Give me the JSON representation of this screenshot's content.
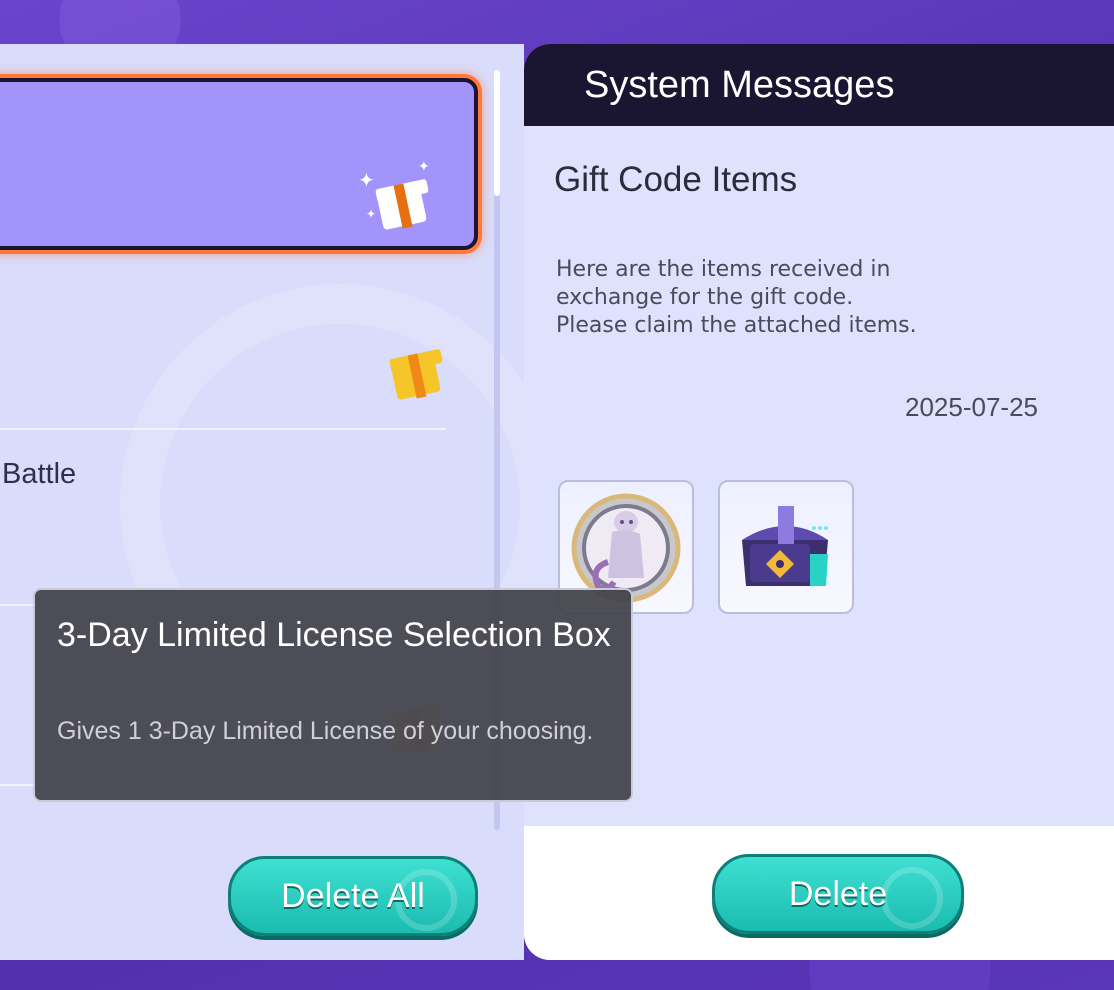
{
  "colors": {
    "accent_teal": "#2ccfc3",
    "selected_card": "#a294fb",
    "selected_glow": "#ff7a3a",
    "header_dark": "#1a1530",
    "background_purple": "#5a36b8"
  },
  "message_list": {
    "items": [
      {
        "label": "",
        "icon": "gift-sparkle-icon",
        "selected": true
      },
      {
        "label": "",
        "icon": "gift-icon"
      },
      {
        "label": "Battle",
        "icon": ""
      },
      {
        "label": "",
        "icon": "gift-icon"
      }
    ],
    "delete_all_label": "Delete All"
  },
  "detail": {
    "header": "System Messages",
    "title": "Gift Code Items",
    "body": "Here are the items received in\nexchange for the gift code.\nPlease claim the attached items.",
    "date": "2025-07-25",
    "attachments": [
      {
        "icon": "mewtwo-medal-icon"
      },
      {
        "icon": "license-selection-box-icon"
      }
    ],
    "delete_label": "Delete"
  },
  "tooltip": {
    "title": "3-Day Limited License Selection Box",
    "description": "Gives 1 3-Day Limited License of your choosing."
  }
}
